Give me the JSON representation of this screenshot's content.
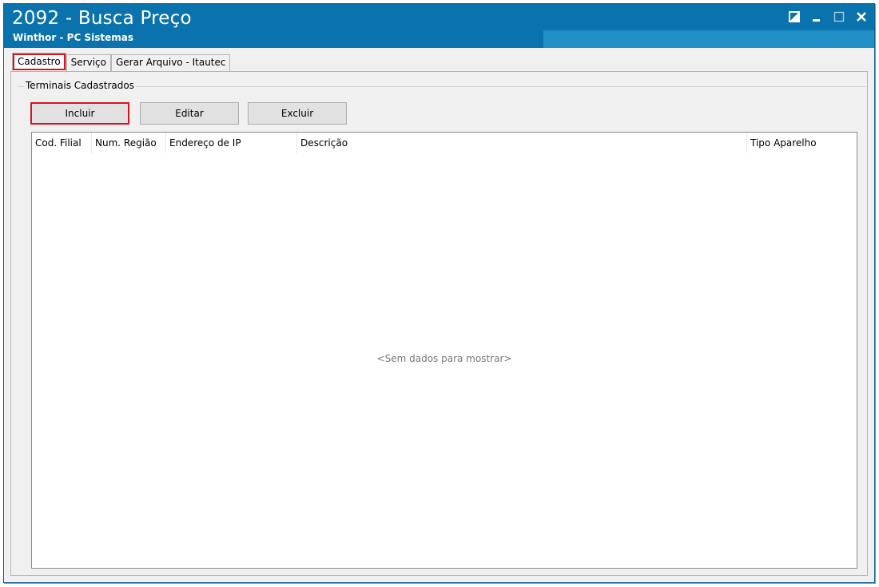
{
  "window": {
    "title": "2092 - Busca Preço",
    "subtitle": "Winthor - PC Sistemas",
    "controls": [
      "restore-icon",
      "minimize-icon",
      "maximize-icon",
      "close-icon"
    ]
  },
  "tabs": [
    {
      "label": "Cadastro",
      "active": true
    },
    {
      "label": "Serviço",
      "active": false
    },
    {
      "label": "Gerar Arquivo - Itautec",
      "active": false
    }
  ],
  "group": {
    "label": "Terminais Cadastrados"
  },
  "buttons": {
    "incluir": "Incluir",
    "editar": "Editar",
    "excluir": "Excluir"
  },
  "grid": {
    "columns": [
      "Cod. Filial",
      "Num. Região",
      "Endereço de IP",
      "Descrição",
      "Tipo Aparelho"
    ],
    "rows": [],
    "empty_message": "<Sem dados para mostrar>"
  },
  "colors": {
    "titlebar": "#0a73ad",
    "highlight": "#d8131e"
  }
}
